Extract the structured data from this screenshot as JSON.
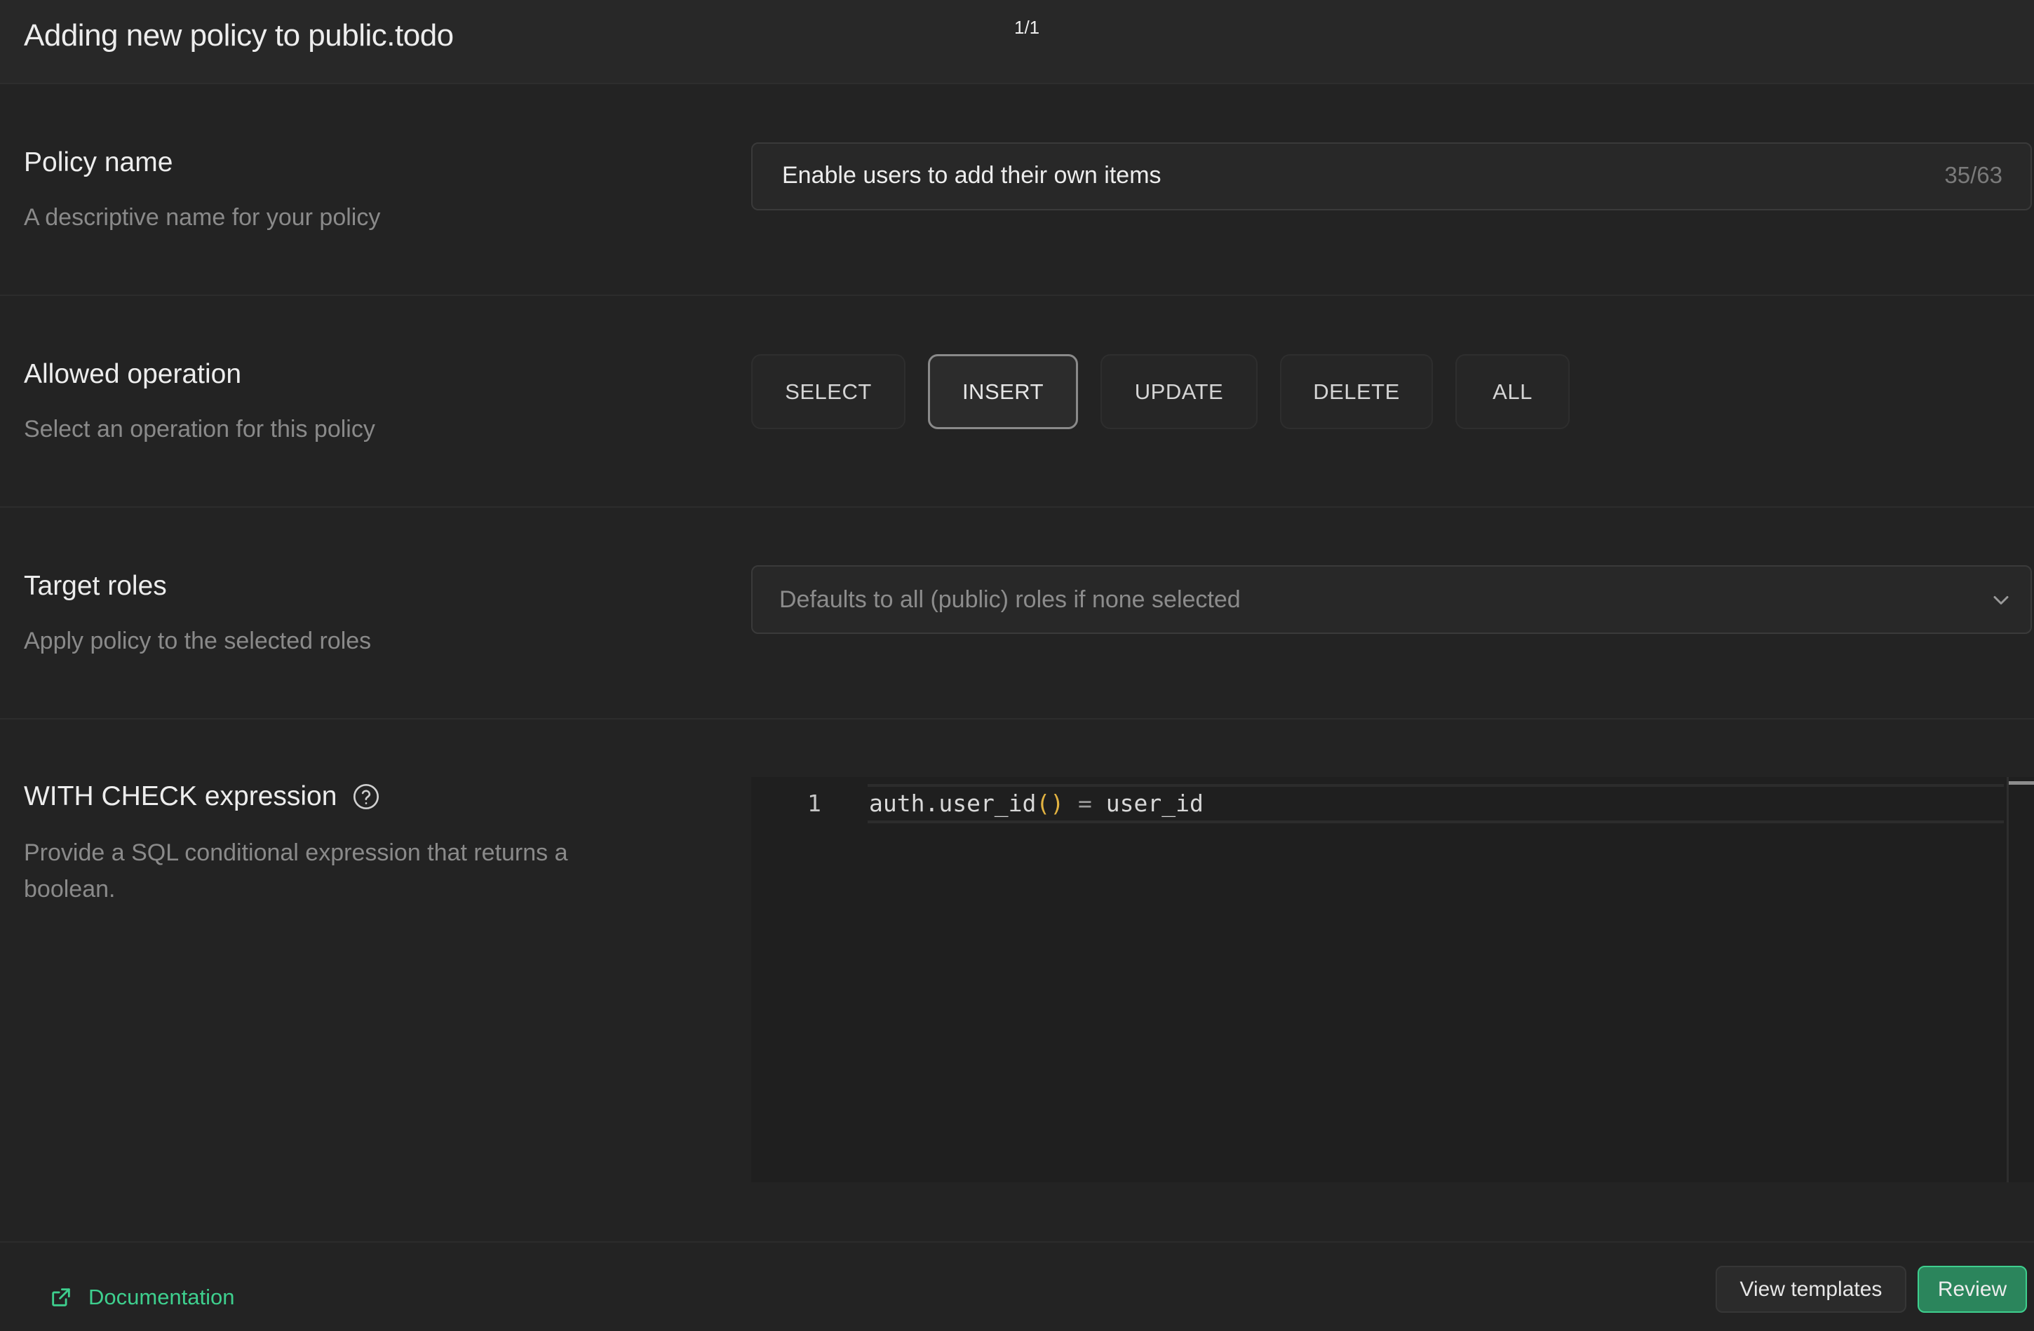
{
  "header": {
    "title": "Adding new policy to public.todo",
    "page_counter": "1/1"
  },
  "policy_name": {
    "label": "Policy name",
    "description": "A descriptive name for your policy",
    "value": "Enable users to add their own items",
    "char_count": "35/63"
  },
  "allowed_operation": {
    "label": "Allowed operation",
    "description": "Select an operation for this policy",
    "options": [
      "SELECT",
      "INSERT",
      "UPDATE",
      "DELETE",
      "ALL"
    ],
    "selected": "INSERT"
  },
  "target_roles": {
    "label": "Target roles",
    "description": "Apply policy to the selected roles",
    "placeholder": "Defaults to all (public) roles if none selected",
    "icon": "chevron-down-icon"
  },
  "with_check": {
    "label": "WITH CHECK expression",
    "help_icon": "help-circle-icon",
    "description": "Provide a SQL conditional expression that returns a boolean.",
    "editor": {
      "lines": [
        {
          "number": "1",
          "tokens": {
            "fn": "auth.user_id",
            "parens": "()",
            "op": " = ",
            "rhs": "user_id"
          }
        }
      ]
    }
  },
  "footer": {
    "documentation_label": "Documentation",
    "documentation_icon": "external-link-icon",
    "view_templates_label": "View templates",
    "review_label": "Review"
  },
  "colors": {
    "accent": "#3ecf8e",
    "primary_button": "#2b855c",
    "background": "#232323",
    "paren_highlight": "#e3b341"
  }
}
